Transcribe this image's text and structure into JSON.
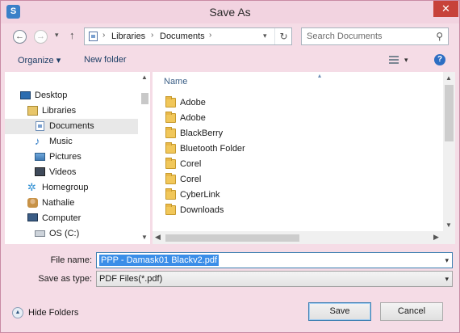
{
  "window": {
    "title": "Save As",
    "app_icon": "dialog-app-icon",
    "close_glyph": "✕"
  },
  "navigation": {
    "back_glyph": "←",
    "forward_glyph": "→",
    "recent_glyph": "▾",
    "up_glyph": "↑",
    "breadcrumb": [
      "Libraries",
      "Documents"
    ],
    "breadcrumb_separator": "›",
    "address_dropdown_glyph": "▾",
    "refresh_glyph": "↻",
    "search_placeholder": "Search Documents",
    "search_glyph": "⚲"
  },
  "toolbar": {
    "organize_label": "Organize ▾",
    "new_folder_label": "New folder",
    "view_dropdown_glyph": "▾",
    "help_glyph": "?"
  },
  "nav_tree": {
    "items": [
      {
        "label": "Desktop",
        "icon": "desktop-icon"
      },
      {
        "label": "Libraries",
        "icon": "libraries-icon"
      },
      {
        "label": "Documents",
        "icon": "documents-icon",
        "selected": true
      },
      {
        "label": "Music",
        "icon": "music-icon"
      },
      {
        "label": "Pictures",
        "icon": "pictures-icon"
      },
      {
        "label": "Videos",
        "icon": "videos-icon"
      },
      {
        "label": "Homegroup",
        "icon": "homegroup-icon"
      },
      {
        "label": "Nathalie",
        "icon": "user-folder-icon"
      },
      {
        "label": "Computer",
        "icon": "computer-icon"
      },
      {
        "label": "OS (C:)",
        "icon": "drive-icon"
      }
    ],
    "scroll_up_glyph": "▲",
    "scroll_down_glyph": "▼"
  },
  "file_list": {
    "column_header": "Name",
    "sort_glyph": "▴",
    "files": [
      {
        "name": "Adobe",
        "icon": "folder-icon"
      },
      {
        "name": "Adobe",
        "icon": "folder-icon"
      },
      {
        "name": "BlackBerry",
        "icon": "folder-icon"
      },
      {
        "name": "Bluetooth Folder",
        "icon": "folder-icon"
      },
      {
        "name": "Corel",
        "icon": "folder-icon"
      },
      {
        "name": "Corel",
        "icon": "folder-icon"
      },
      {
        "name": "CyberLink",
        "icon": "folder-icon"
      },
      {
        "name": "Downloads",
        "icon": "folder-icon"
      }
    ],
    "scroll_up_glyph": "▲",
    "scroll_down_glyph": "▼",
    "scroll_left_glyph": "◀",
    "scroll_right_glyph": "▶"
  },
  "form": {
    "file_name_label": "File name:",
    "file_name_value": "PPP - Damask01 Blackv2.pdf",
    "save_type_label": "Save as type:",
    "save_type_value": "PDF Files(*.pdf)",
    "dropdown_glyph": "▾"
  },
  "footer": {
    "hide_folders_glyph": "▲",
    "hide_folders_label": "Hide Folders",
    "save_label": "Save",
    "cancel_label": "Cancel"
  },
  "colors": {
    "chrome": "#f5dce6",
    "close_button": "#c7423a",
    "selection": "#3b8ee8",
    "focus_border": "#3c7fb1"
  }
}
